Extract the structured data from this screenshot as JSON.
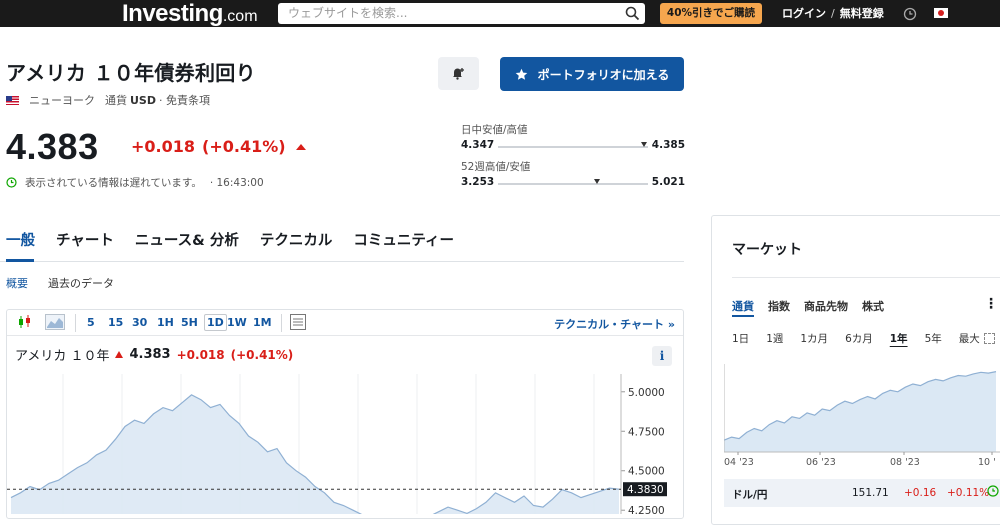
{
  "topbar": {
    "logo_main": "Investing",
    "logo_suffix": ".com",
    "search_placeholder": "ウェブサイトを検索...",
    "promo": "40%引きでご購読",
    "login": "ログイン",
    "signup": "無料登録"
  },
  "instrument": {
    "title": "アメリカ １０年債券利回り",
    "exchange": "ニューヨーク",
    "currency_label": "通貨",
    "currency": "USD",
    "disclaimer": "· 免責条項",
    "price": "4.383",
    "change": "+0.018",
    "change_pct": "(+0.41%)",
    "delay_note": "表示されている情報は遅れています。",
    "time": "· 16:43:00"
  },
  "buttons": {
    "portfolio": "ポートフォリオに加える"
  },
  "ranges": {
    "day_label": "日中安値/高値",
    "day_low": "4.347",
    "day_high": "4.385",
    "day_position": 0.95,
    "week52_label": "52週高値/安値",
    "week52_low": "3.253",
    "week52_high": "5.021",
    "week52_position": 0.64
  },
  "tabs": [
    "一般",
    "チャート",
    "ニュース& 分析",
    "テクニカル",
    "コミュニティー"
  ],
  "subtabs": [
    "概要",
    "過去のデータ"
  ],
  "chart_toolbar": {
    "timeframes": [
      "5",
      "15",
      "30",
      "1H",
      "5H",
      "1D",
      "1W",
      "1M"
    ],
    "selected": "1D",
    "technical_link": "テクニカル・チャート »"
  },
  "chart_header": {
    "name": "アメリカ １０年",
    "price": "4.383",
    "change": "+0.018",
    "change_pct": "(+0.41%)"
  },
  "chart_data": {
    "type": "area",
    "y_ticks": [
      "5.0000",
      "4.7500",
      "4.5000",
      "4.2500"
    ],
    "current_label": "4.3830",
    "ylim": [
      4.15,
      5.1
    ],
    "values": [
      4.33,
      4.36,
      4.4,
      4.38,
      4.42,
      4.44,
      4.48,
      4.52,
      4.55,
      4.6,
      4.63,
      4.7,
      4.78,
      4.82,
      4.8,
      4.86,
      4.9,
      4.88,
      4.93,
      4.98,
      4.95,
      4.9,
      4.92,
      4.85,
      4.8,
      4.72,
      4.68,
      4.62,
      4.64,
      4.55,
      4.5,
      4.46,
      4.4,
      4.36,
      4.3,
      4.28,
      4.25,
      4.22,
      4.2,
      4.21,
      4.19,
      4.18,
      4.2,
      4.22,
      4.21,
      4.24,
      4.27,
      4.25,
      4.23,
      4.26,
      4.3,
      4.36,
      4.33,
      4.3,
      4.34,
      4.28,
      4.27,
      4.32,
      4.38,
      4.36,
      4.33,
      4.35,
      4.37,
      4.39,
      4.383
    ],
    "dashed_level": 4.383
  },
  "market_panel": {
    "title": "マーケット",
    "tabs": [
      "通貨",
      "指数",
      "商品先物",
      "株式"
    ],
    "ranges": [
      "1日",
      "1週",
      "1カ月",
      "6カ月",
      "1年",
      "5年",
      "最大"
    ],
    "selected_range": "1年",
    "x_labels": [
      "04 '23",
      "06 '23",
      "08 '23",
      "10 '"
    ],
    "series": [
      0.1,
      0.14,
      0.12,
      0.2,
      0.25,
      0.22,
      0.3,
      0.35,
      0.32,
      0.4,
      0.38,
      0.45,
      0.42,
      0.5,
      0.48,
      0.55,
      0.6,
      0.57,
      0.62,
      0.66,
      0.63,
      0.7,
      0.74,
      0.72,
      0.78,
      0.82,
      0.8,
      0.85,
      0.88,
      0.86,
      0.9,
      0.93,
      0.92,
      0.95,
      0.97,
      0.96,
      0.98
    ],
    "row": {
      "pair": "ドル/円",
      "price": "151.71",
      "change": "+0.16",
      "change_pct": "+0.11%"
    }
  }
}
